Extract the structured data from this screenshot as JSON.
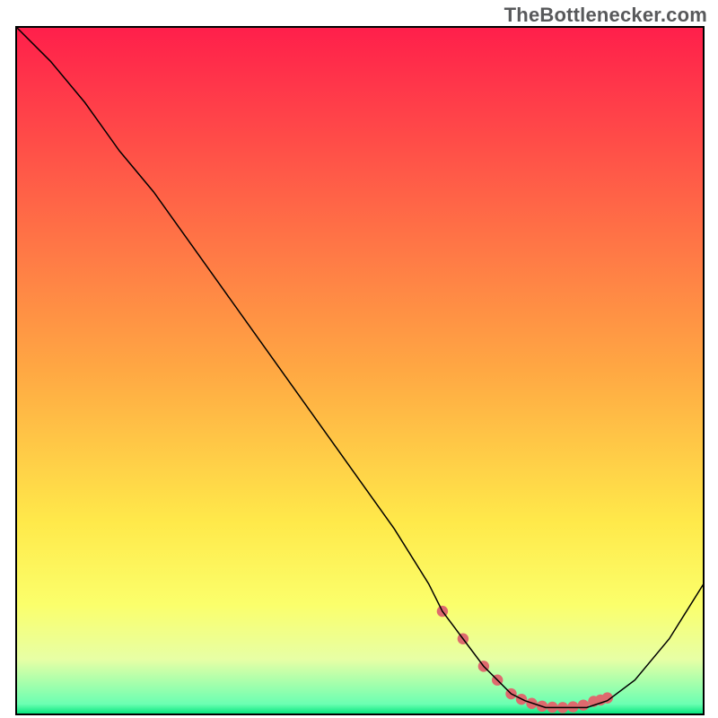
{
  "watermark": "TheBottlenecker.com",
  "chart_data": {
    "type": "line",
    "title": "",
    "xlabel": "",
    "ylabel": "",
    "xlim": [
      0,
      100
    ],
    "ylim": [
      0,
      100
    ],
    "grid": false,
    "legend": false,
    "annotations": [],
    "background": {
      "type": "vertical-gradient",
      "stops": [
        {
          "offset": 0.0,
          "color": "#ff1f4b"
        },
        {
          "offset": 0.5,
          "color": "#ffa843"
        },
        {
          "offset": 0.72,
          "color": "#ffe94a"
        },
        {
          "offset": 0.84,
          "color": "#fbff6b"
        },
        {
          "offset": 0.92,
          "color": "#e7ffa5"
        },
        {
          "offset": 0.985,
          "color": "#6bffb2"
        },
        {
          "offset": 1.0,
          "color": "#00e37a"
        }
      ]
    },
    "series": [
      {
        "name": "bottleneck-curve",
        "color": "#000000",
        "stroke_width": 1.5,
        "x": [
          0,
          5,
          10,
          15,
          20,
          25,
          30,
          35,
          40,
          45,
          50,
          55,
          60,
          62,
          65,
          68,
          70,
          72,
          74,
          77,
          80,
          83,
          86,
          90,
          95,
          100
        ],
        "values": [
          100,
          95,
          89,
          82,
          76,
          69,
          62,
          55,
          48,
          41,
          34,
          27,
          19,
          15,
          11,
          7,
          5,
          3,
          2,
          1,
          1,
          1,
          2,
          5,
          11,
          19
        ]
      }
    ],
    "highlight": {
      "name": "optimal-region",
      "color": "#de6a6e",
      "dot_radius": 6.2,
      "x": [
        62,
        65,
        68,
        70,
        72,
        73.5,
        75,
        76.5,
        78,
        79.5,
        81,
        82.5,
        84,
        85,
        86
      ],
      "values": [
        15,
        11,
        7,
        5,
        3,
        2.2,
        1.6,
        1.2,
        1.05,
        1.0,
        1.1,
        1.35,
        1.9,
        2.1,
        2.4
      ]
    }
  }
}
